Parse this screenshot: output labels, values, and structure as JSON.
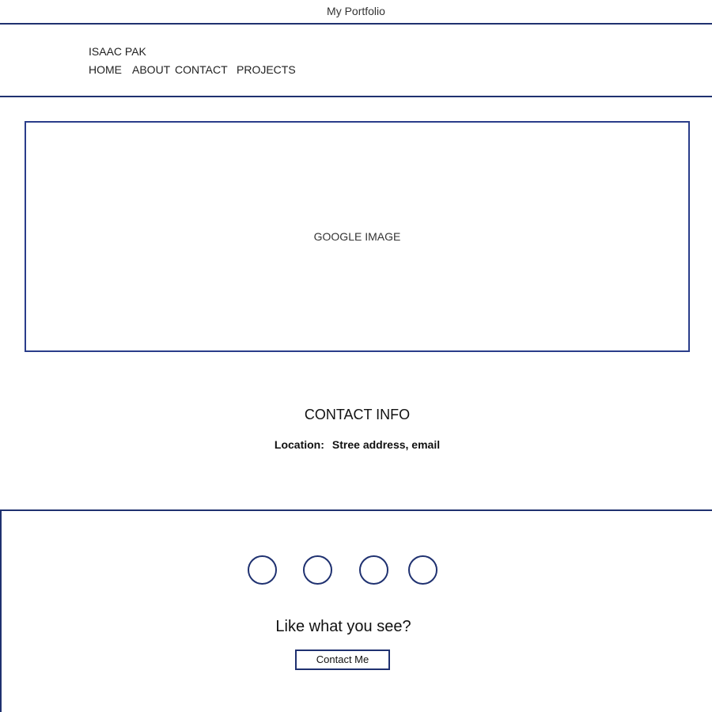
{
  "window": {
    "title": "My Portfolio"
  },
  "header": {
    "site_name": "ISAAC PAK",
    "nav": {
      "home": "HOME",
      "about": "ABOUT",
      "contact": "CONTACT",
      "projects": "PROJECTS"
    }
  },
  "hero": {
    "label": "GOOGLE IMAGE"
  },
  "contact_info": {
    "heading": "CONTACT INFO",
    "location_label": "Location:",
    "location_value": "Stree address, email"
  },
  "footer": {
    "social_icons": [
      "social-icon",
      "social-icon",
      "social-icon",
      "social-icon"
    ],
    "cta_text": "Like what you see?",
    "cta_button": "Contact Me"
  },
  "colors": {
    "accent": "#1f3170",
    "text": "#222222",
    "background": "#ffffff"
  }
}
